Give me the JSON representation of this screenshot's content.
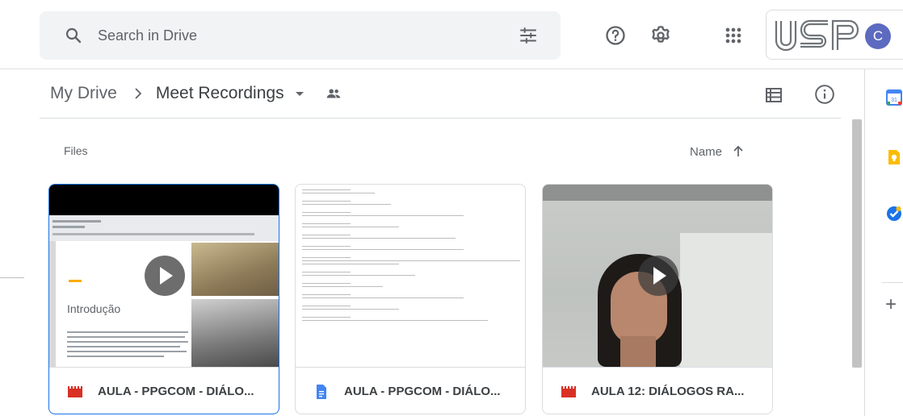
{
  "search": {
    "placeholder": "Search in Drive"
  },
  "header": {
    "logo_text": "USP",
    "avatar_letter": "C"
  },
  "breadcrumb": {
    "root": "My Drive",
    "current": "Meet Recordings"
  },
  "files_section": {
    "label": "Files",
    "sort_label": "Name",
    "sort_direction": "ascending"
  },
  "files": [
    {
      "name": "AULA - PPGCOM - DIÁLO...",
      "type": "video",
      "icon": "video-file-icon",
      "thumb_title": "Introdução",
      "selected": true
    },
    {
      "name": "AULA - PPGCOM - DIÁLO...",
      "type": "document",
      "icon": "docs-file-icon",
      "selected": false
    },
    {
      "name": "AULA 12: DIÁLOGOS RA...",
      "type": "video",
      "icon": "video-file-icon",
      "selected": false
    }
  ],
  "right_rail": [
    "calendar-icon",
    "keep-icon",
    "tasks-icon",
    "add-icon"
  ],
  "colors": {
    "accent": "#1a73e8",
    "video_icon": "#d93025",
    "doc_icon": "#4285f4",
    "avatar": "#5c6bc0"
  }
}
